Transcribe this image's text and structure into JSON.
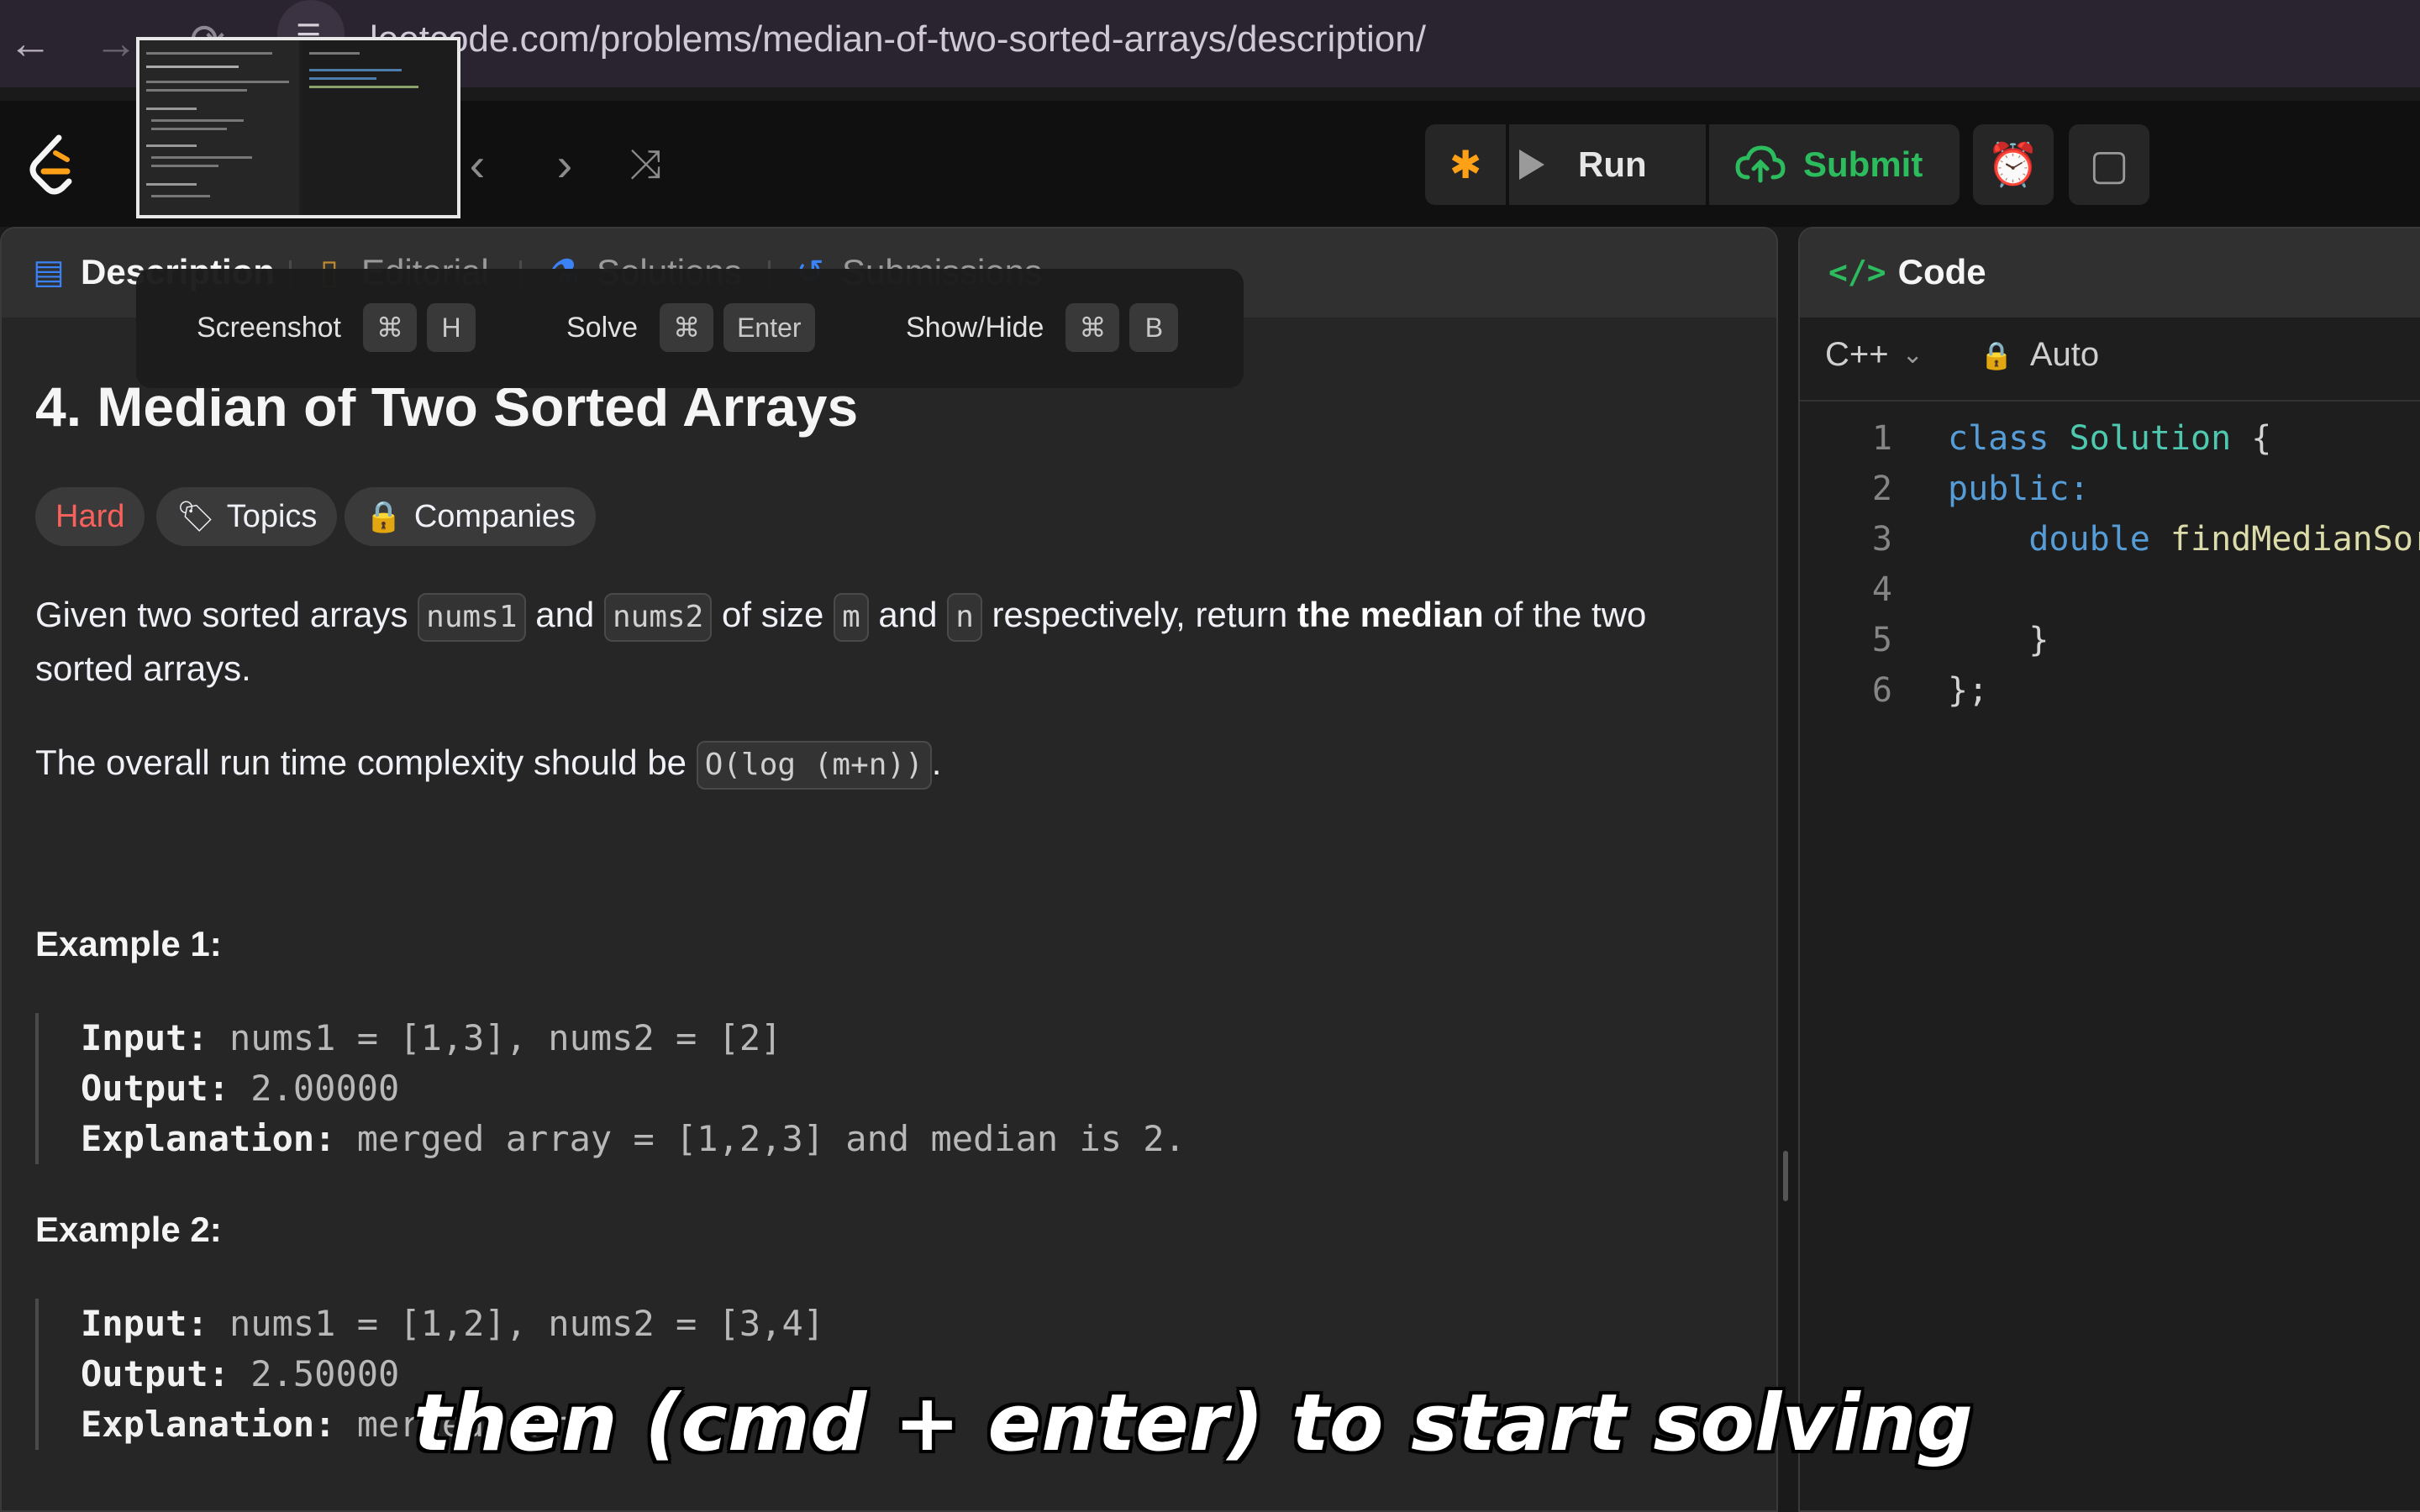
{
  "browser": {
    "url": "leetcode.com/problems/median-of-two-sorted-arrays/description/"
  },
  "toolbar": {
    "run_label": "Run",
    "submit_label": "Submit"
  },
  "shortcuts": [
    {
      "label": "Screenshot",
      "keys": [
        "⌘",
        "H"
      ]
    },
    {
      "label": "Solve",
      "keys": [
        "⌘",
        "Enter"
      ]
    },
    {
      "label": "Show/Hide",
      "keys": [
        "⌘",
        "B"
      ]
    }
  ],
  "tabs": [
    {
      "label": "Description",
      "icon": "document-icon",
      "active": true
    },
    {
      "label": "Editorial",
      "icon": "book-icon"
    },
    {
      "label": "Solutions",
      "icon": "flask-icon"
    },
    {
      "label": "Submissions",
      "icon": "history-icon"
    }
  ],
  "problem": {
    "title": "4. Median of Two Sorted Arrays",
    "tags": {
      "difficulty": "Hard",
      "topics": "Topics",
      "companies": "Companies"
    },
    "desc": {
      "p1_a": "Given two sorted arrays ",
      "code_nums1": "nums1",
      "p1_b": " and ",
      "code_nums2": "nums2",
      "p1_c": " of size ",
      "code_m": "m",
      "p1_d": " and ",
      "code_n": "n",
      "p1_e": " respectively, return ",
      "p1_bold": "the median",
      "p1_f": " of the two sorted arrays.",
      "p2_a": "The overall run time complexity should be ",
      "code_complexity": "O(log (m+n))",
      "p2_b": "."
    },
    "examples": [
      {
        "title": "Example 1:",
        "input_label": "Input:",
        "input": " nums1 = [1,3], nums2 = [2]",
        "output_label": "Output:",
        "output": " 2.00000",
        "explanation_label": "Explanation:",
        "explanation": " merged array = [1,2,3] and median is 2."
      },
      {
        "title": "Example 2:",
        "input_label": "Input:",
        "input": " nums1 = [1,2], nums2 = [3,4]",
        "output_label": "Output:",
        "output": " 2.50000",
        "explanation_label": "Explanation:",
        "explanation": " merged arr"
      }
    ]
  },
  "code_panel": {
    "title": "Code",
    "language": "C++",
    "mode": "Auto",
    "lines": [
      {
        "num": "1",
        "tokens": [
          {
            "t": "class",
            "c": "kw"
          },
          {
            "t": " ",
            "c": "pl"
          },
          {
            "t": "Solution",
            "c": "ty"
          },
          {
            "t": " {",
            "c": "pl"
          }
        ]
      },
      {
        "num": "2",
        "tokens": [
          {
            "t": "public:",
            "c": "kw"
          }
        ]
      },
      {
        "num": "3",
        "tokens": [
          {
            "t": "    ",
            "c": "pl"
          },
          {
            "t": "double",
            "c": "kw"
          },
          {
            "t": " ",
            "c": "pl"
          },
          {
            "t": "findMedianSort",
            "c": "fn"
          }
        ]
      },
      {
        "num": "4",
        "tokens": []
      },
      {
        "num": "5",
        "tokens": [
          {
            "t": "    }",
            "c": "pl"
          }
        ]
      },
      {
        "num": "6",
        "tokens": [
          {
            "t": "};",
            "c": "pl"
          }
        ]
      }
    ]
  },
  "caption": "then (cmd + enter) to start solving"
}
